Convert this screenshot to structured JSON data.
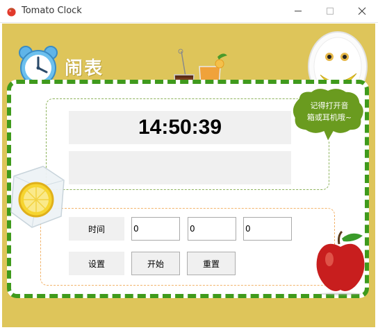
{
  "window": {
    "title": "Tomato Clock",
    "app_icon": "tomato-icon",
    "controls": [
      "minimize-icon",
      "maximize-icon",
      "close-icon"
    ]
  },
  "header": {
    "title_cn": "闹表",
    "clock_icon": "alarm-clock-icon"
  },
  "display": {
    "time": "14:50:39",
    "message": ""
  },
  "bubble": {
    "line1": "记得打开音",
    "line2": "箱或耳机哦~"
  },
  "controls": {
    "time_label": "时间",
    "hours_value": "0",
    "minutes_value": "0",
    "seconds_value": "0",
    "settings_label": "设置",
    "start_label": "开始",
    "reset_label": "重置"
  },
  "colors": {
    "background": "#dec55a",
    "border_green": "#3f9a1c",
    "bubble_green": "#6a9b1f"
  }
}
